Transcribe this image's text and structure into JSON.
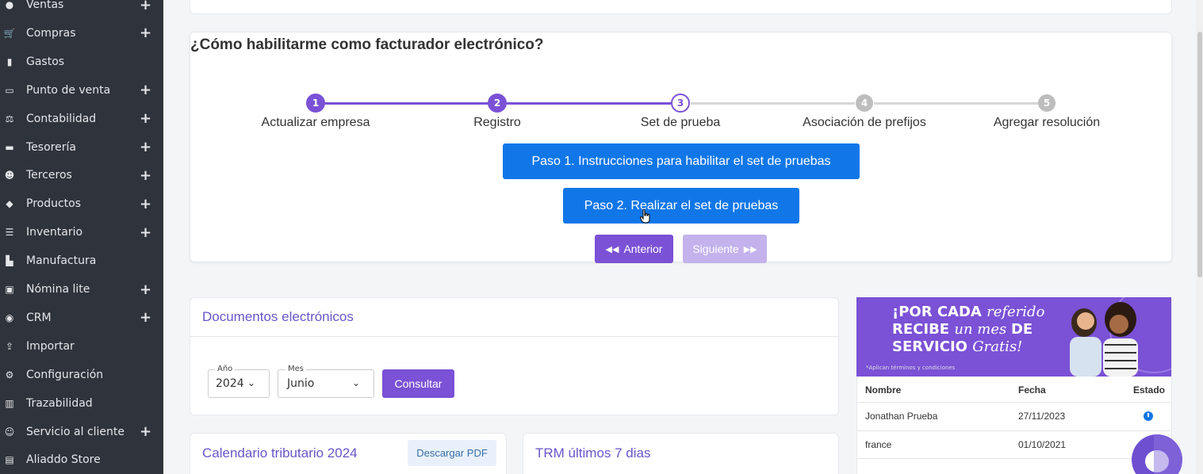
{
  "sidebar": {
    "items": [
      {
        "label": "Ventas",
        "icon": "money-bag-icon",
        "plus": true
      },
      {
        "label": "Compras",
        "icon": "cart-icon",
        "plus": true
      },
      {
        "label": "Gastos",
        "icon": "receipt-icon",
        "plus": false
      },
      {
        "label": "Punto de venta",
        "icon": "register-icon",
        "plus": true
      },
      {
        "label": "Contabilidad",
        "icon": "scale-icon",
        "plus": true
      },
      {
        "label": "Tesorería",
        "icon": "cash-icon",
        "plus": true
      },
      {
        "label": "Terceros",
        "icon": "users-icon",
        "plus": true
      },
      {
        "label": "Productos",
        "icon": "tags-icon",
        "plus": true
      },
      {
        "label": "Inventario",
        "icon": "pallet-icon",
        "plus": true
      },
      {
        "label": "Manufactura",
        "icon": "factory-icon",
        "plus": false
      },
      {
        "label": "Nómina lite",
        "icon": "payroll-icon",
        "plus": true
      },
      {
        "label": "CRM",
        "icon": "crm-icon",
        "plus": true
      },
      {
        "label": "Importar",
        "icon": "upload-icon",
        "plus": false
      },
      {
        "label": "Configuración",
        "icon": "cogs-icon",
        "plus": false
      },
      {
        "label": "Trazabilidad",
        "icon": "chart-icon",
        "plus": false
      },
      {
        "label": "Servicio al cliente",
        "icon": "support-icon",
        "plus": true
      },
      {
        "label": "Aliaddo Store",
        "icon": "store-icon",
        "plus": false
      }
    ],
    "plus_glyph": "+"
  },
  "wizard": {
    "title": "¿Cómo habilitarme como facturador electrónico?",
    "steps": [
      {
        "num": "1",
        "label": "Actualizar empresa",
        "state": "done"
      },
      {
        "num": "2",
        "label": "Registro",
        "state": "done"
      },
      {
        "num": "3",
        "label": "Set de prueba",
        "state": "current"
      },
      {
        "num": "4",
        "label": "Asociación de prefijos",
        "state": "pending"
      },
      {
        "num": "5",
        "label": "Agregar resolución",
        "state": "pending"
      }
    ],
    "btn_paso1": "Paso 1. Instrucciones para habilitar el set de pruebas",
    "btn_paso2": "Paso 2. Realizar el set de pruebas",
    "btn_anterior": "Anterior",
    "btn_siguiente": "Siguiente"
  },
  "documentos": {
    "title": "Documentos electrónicos",
    "year_legend": "Año",
    "year_value": "2024",
    "month_legend": "Mes",
    "month_value": "Junio",
    "consultar": "Consultar"
  },
  "calendario": {
    "title": "Calendario tributario 2024",
    "download": "Descargar PDF"
  },
  "trm": {
    "title": "TRM últimos 7 dias"
  },
  "promo": {
    "line1_a": "¡POR CADA ",
    "line1_b": "referido",
    "line2_a": "RECIBE ",
    "line2_b": "un mes ",
    "line2_c": "DE",
    "line3_a": "SERVICIO ",
    "line3_b": "Gratis!",
    "small": "*Aplican términos y condiciones"
  },
  "referidos": {
    "headers": [
      "Nombre",
      "Fecha",
      "Estado"
    ],
    "rows": [
      {
        "nombre": "Jonathan Prueba",
        "fecha": "27/11/2023",
        "estado": "pending"
      },
      {
        "nombre": "france",
        "fecha": "01/10/2021",
        "estado": ""
      }
    ]
  },
  "colors": {
    "sidebar_bg": "#2f333b",
    "accent_purple": "#7b51d6",
    "primary_blue": "#1177e8",
    "pending_gray": "#bdbdbd"
  }
}
